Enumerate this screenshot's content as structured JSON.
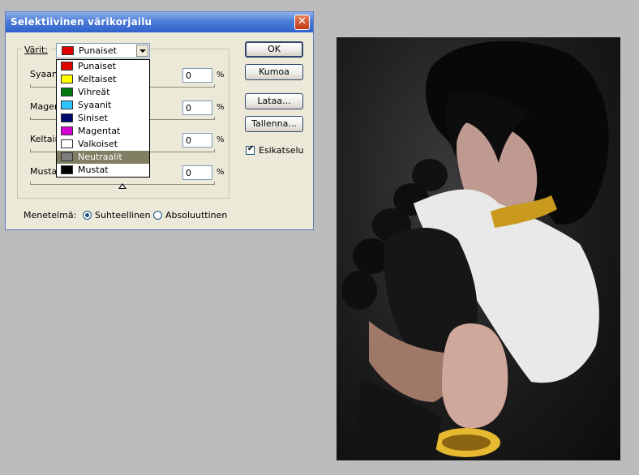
{
  "dialog": {
    "title": "Selektiivinen värikorjailu",
    "close_label": "✕",
    "colors_label": "Värit:",
    "selected_color": {
      "label": "Punaiset",
      "swatch": "#e00000"
    },
    "color_options": [
      {
        "label": "Punaiset",
        "swatch": "#e00000"
      },
      {
        "label": "Keltaiset",
        "swatch": "#ffff00"
      },
      {
        "label": "Vihreät",
        "swatch": "#007a10"
      },
      {
        "label": "Syaanit",
        "swatch": "#2ec4ff"
      },
      {
        "label": "Siniset",
        "swatch": "#000a6e"
      },
      {
        "label": "Magentat",
        "swatch": "#d400d4"
      },
      {
        "label": "Valkoiset",
        "swatch": "#ffffff"
      },
      {
        "label": "Neutraalit",
        "swatch": "#7d7d7d",
        "highlighted": true
      },
      {
        "label": "Mustat",
        "swatch": "#000000"
      }
    ],
    "sliders": [
      {
        "label": "Syaan",
        "value": "0",
        "unit": "%"
      },
      {
        "label": "Magen",
        "value": "0",
        "unit": "%"
      },
      {
        "label": "Keltain",
        "value": "0",
        "unit": "%"
      },
      {
        "label": "Musta",
        "value": "0",
        "unit": "%"
      }
    ],
    "buttons": {
      "ok": "OK",
      "cancel": "Kumoa",
      "load": "Lataa...",
      "save": "Tallenna..."
    },
    "preview": {
      "label": "Esikatselu",
      "checked": true
    },
    "method": {
      "label": "Menetelmä:",
      "options": [
        {
          "label": "Suhteellinen",
          "selected": true
        },
        {
          "label": "Absoluuttinen",
          "selected": false
        }
      ]
    }
  },
  "photo": {
    "description_icon": "image-preview"
  },
  "colors": {
    "titlebar": "#2f62cc",
    "dialog_bg": "#ece9d8",
    "workspace_bg": "#bcbcbc",
    "highlight": "#807f63"
  }
}
